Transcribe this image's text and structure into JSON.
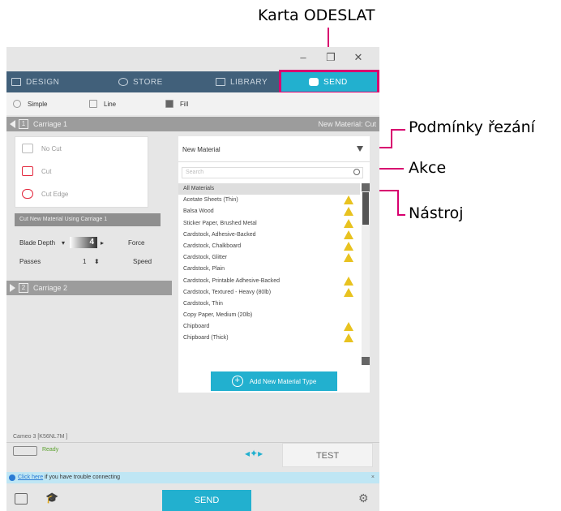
{
  "callouts": {
    "send_tab": "Karta ODESLAT",
    "cut_conditions": "Podmínky řezání",
    "action": "Akce",
    "tool": "Nástroj"
  },
  "window": {
    "controls": [
      "–",
      "❐",
      "✕"
    ]
  },
  "nav_tabs": [
    {
      "label": "DESIGN",
      "icon": "design-icon",
      "active": false
    },
    {
      "label": "STORE",
      "icon": "store-icon",
      "active": false
    },
    {
      "label": "LIBRARY",
      "icon": "library-icon",
      "active": false
    },
    {
      "label": "SEND",
      "icon": "send-icon",
      "active": true
    }
  ],
  "modes": [
    {
      "label": "Simple",
      "icon": "simple-icon"
    },
    {
      "label": "Line",
      "icon": "line-icon"
    },
    {
      "label": "Fill",
      "icon": "fill-icon"
    }
  ],
  "carriage1": {
    "label": "Carriage 1",
    "number": "1",
    "right_label": "New Material: Cut"
  },
  "actions": [
    {
      "label": "No Cut",
      "enabled": false
    },
    {
      "label": "Cut",
      "enabled": true
    },
    {
      "label": "Cut Edge",
      "enabled": true
    }
  ],
  "cut_bar": "Cut New Material Using Carriage 1",
  "settings": {
    "blade_depth_label": "Blade Depth",
    "blade_depth_value": "4",
    "force_label": "Force",
    "passes_label": "Passes",
    "passes_value": "1",
    "speed_label": "Speed"
  },
  "carriage2": {
    "label": "Carriage 2",
    "number": "2"
  },
  "material": {
    "selected": "New Material",
    "search_placeholder": "Search",
    "list": [
      {
        "name": "All Materials",
        "warn": false
      },
      {
        "name": "Acetate Sheets (Thin)",
        "warn": true
      },
      {
        "name": "Balsa Wood",
        "warn": true
      },
      {
        "name": "Sticker Paper, Brushed Metal",
        "warn": true
      },
      {
        "name": "Cardstock, Adhesive-Backed",
        "warn": true
      },
      {
        "name": "Cardstock, Chalkboard",
        "warn": true
      },
      {
        "name": "Cardstock, Glitter",
        "warn": true
      },
      {
        "name": "Cardstock, Plain",
        "warn": false
      },
      {
        "name": "Cardstock, Printable Adhesive-Backed",
        "warn": true
      },
      {
        "name": "Cardstock, Textured - Heavy (80lb)",
        "warn": true
      },
      {
        "name": "Cardstock, Thin",
        "warn": false
      },
      {
        "name": "Copy Paper, Medium (20lb)",
        "warn": false
      },
      {
        "name": "Chipboard",
        "warn": true
      },
      {
        "name": "Chipboard (Thick)",
        "warn": true
      }
    ],
    "add_button": "Add New Material Type"
  },
  "cutter_name": "Cameo 3 [K56NL7M ]",
  "status": "Ready",
  "test_button": "TEST",
  "info": {
    "link": "Click here",
    "text": " if you have trouble connecting"
  },
  "send_button": "SEND",
  "colors": {
    "accent": "#22b0cf",
    "callout": "#d8006f",
    "nav": "#41607a",
    "warning": "#e8c21f"
  }
}
